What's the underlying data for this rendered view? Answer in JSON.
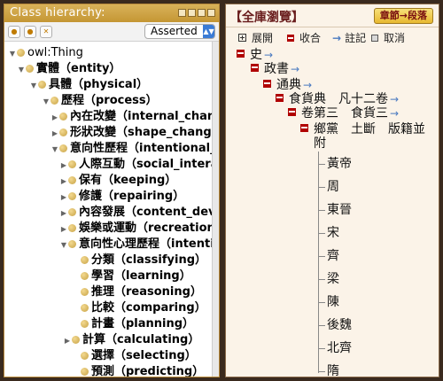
{
  "left_panel": {
    "title": "Class hierarchy:",
    "view_mode": "Asserted",
    "tree": [
      {
        "label": "owl:Thing",
        "bold": false
      },
      {
        "label": "實體（entity）",
        "bold": true
      },
      {
        "label": "具體（physical）",
        "bold": true
      },
      {
        "label": "歷程（process）",
        "bold": true
      },
      {
        "label": "內在改變（internal_chang",
        "bold": true
      },
      {
        "label": "形狀改變（shape_change）",
        "bold": true
      },
      {
        "label": "意向性歷程（intentional_p",
        "bold": true
      },
      {
        "label": "人際互動（social_interac",
        "bold": true
      },
      {
        "label": "保有（keeping）",
        "bold": true
      },
      {
        "label": "修護（repairing）",
        "bold": true
      },
      {
        "label": "內容發展（content_deve",
        "bold": true
      },
      {
        "label": "娛樂或運動（recreation_c",
        "bold": true
      },
      {
        "label": "意向性心理歷程（intention",
        "bold": true
      },
      {
        "label": "分類（classifying）",
        "bold": true
      },
      {
        "label": "學習（learning）",
        "bold": true
      },
      {
        "label": "推理（reasoning）",
        "bold": true
      },
      {
        "label": "比較（comparing）",
        "bold": true
      },
      {
        "label": "計畫（planning）",
        "bold": true
      },
      {
        "label": "計算（calculating）",
        "bold": true
      },
      {
        "label": "選擇（selecting）",
        "bold": true
      },
      {
        "label": "預測（predicting）",
        "bold": true
      }
    ]
  },
  "right_panel": {
    "title": "【全庫瀏覽】",
    "chapter_button": "章節→段落",
    "controls": {
      "expand": "展開",
      "collapse": "收合",
      "annotate": "註記",
      "cancel": "取消"
    },
    "tree": {
      "root": "史",
      "l1": "政書",
      "l2": "通典",
      "l3": "食貨典　凡十二卷",
      "l4": "卷第三　食貨三",
      "l5_line1": "鄉黨　土斷　版籍並",
      "l5_line2": "附",
      "leaves": [
        "黃帝",
        "周",
        "東晉",
        "宋",
        "齊",
        "梁",
        "陳",
        "後魏",
        "北齊",
        "隋"
      ]
    }
  },
  "colors": {
    "left_title_bg": "#c49633",
    "right_bg": "#fbf3e8",
    "collapse_marker": "#b00000",
    "link_arrow": "#4a7ac0",
    "chapter_button_bg": "#e8b830"
  }
}
